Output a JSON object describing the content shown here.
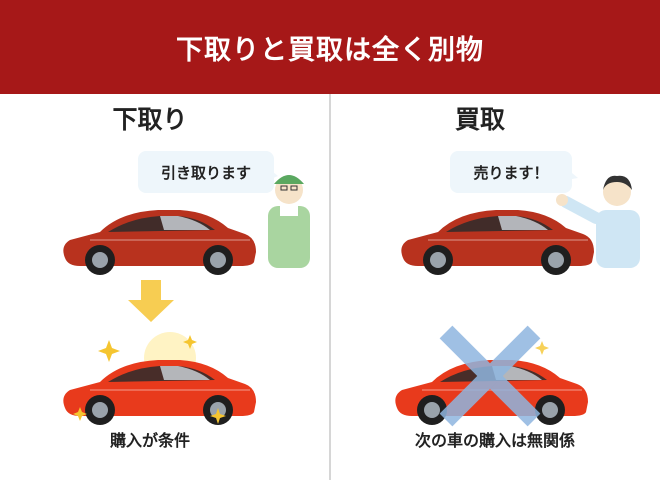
{
  "title": "下取りと買取は全く別物",
  "left": {
    "heading": "下取り",
    "speech": "引き取ります",
    "caption": "購入が条件"
  },
  "right": {
    "heading": "買取",
    "speech": "売ります！",
    "caption": "次の車の購入は無関係"
  },
  "colors": {
    "header": "#a61818",
    "old_car": "#b8321e",
    "new_car": "#e83a1c",
    "arrow": "#f7cd52",
    "cross": "#8fb6e0",
    "bubble": "#eef6fb"
  }
}
